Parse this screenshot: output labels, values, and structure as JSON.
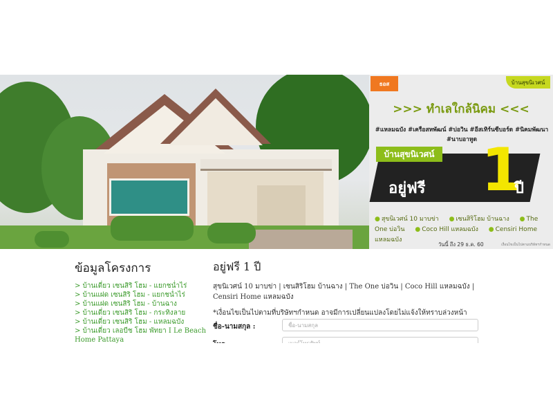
{
  "banner": {
    "promo_heading": ">>> ทำเลใกล้นิคม <<<",
    "logo_left": "ธอส",
    "logo_right": "บ้านสุขนิเวศน์",
    "hashtags": "#แหลมฉบัง #เครือสหพัฒน์ #บ่อวิน #อีสเทิร์นซีบอร์ด #นิคมพัฒนา #นาบอาหูด",
    "tag": "บ้านสุขนิเวศน์",
    "free_text": "อยู่ฟรี",
    "big_number": "1",
    "year_text": "ปี",
    "projects": [
      "สุขนิเวศน์ 10 มาบข่า",
      "เซนสิริโฮม บ้านฉาง",
      "The One บ่อวิน",
      "Coco Hill แหลมฉบัง",
      "Censiri Home แหลมฉบัง"
    ],
    "date": "วันนี้ ถึง 29 ธ.ค. 60",
    "fine_print": "เงื่อนไขเป็นไปตามบริษัทฯกำหนด"
  },
  "sidebar": {
    "title": "ข้อมูลโครงการ",
    "links": [
      "> บ้านเดี่ยว เซนสิริ โฮม - แยกชนํ่าไร่",
      "> บ้านแฝด เซนสิริ โฮม - แยกชนํ่าไร่",
      "> บ้านแฝด เซนสิริ โฮม - บ้านฉาง",
      "> บ้านเดี่ยว เซนสิริ โฮม - กระทิงลาย",
      "> บ้านเดี่ยว เซนสิริ โฮม - แหลมฉบัง",
      "> บ้านเดี่ยว เลอบีช โฮม พัทยา I Le Beach Home Pattaya"
    ]
  },
  "main": {
    "title": "อยู่ฟรี 1 ปี",
    "description": "สุขนิเวศน์ 10 มาบข่า | เซนสิริโฮม บ้านฉาง | The One บ่อวิน | Coco Hill แหลมฉบัง | Censiri Home แหลมฉบัง",
    "note": "*เงื่อนไขเป็นไปตามที่บริษัทฯกำหนด อาจมีการเปลี่ยนแปลงโดยไม่แจ้งให้ทราบล่วงหน้า",
    "form": {
      "name_label": "ชื่อ-นามสกุล :",
      "name_placeholder": "ชื่อ-นามสกุล",
      "phone_label": "โทร :",
      "phone_placeholder": "เบอร์โทรศัพท์"
    }
  }
}
